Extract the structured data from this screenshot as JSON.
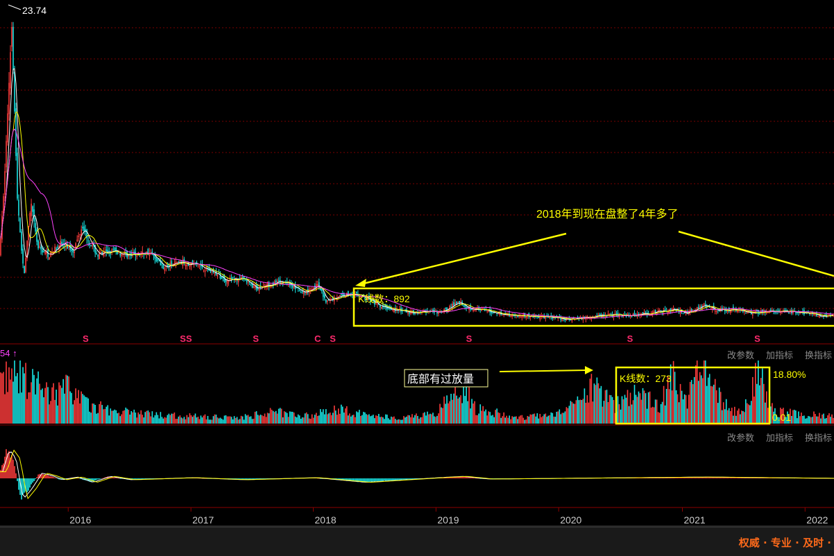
{
  "toolbar_vol": {
    "change_params": "改参数",
    "add_indicator": "加指标",
    "switch_indicator": "换指标"
  },
  "toolbar_macd": {
    "change_params": "改参数",
    "add_indicator": "加指标",
    "switch_indicator": "换指标"
  },
  "footer": {
    "slogan": "权威 · 专业 · 及时 ·"
  },
  "colors": {
    "up": "#ff3d3d",
    "down": "#19e6e6",
    "highlight": "#ffff00",
    "grid": "#8b0000",
    "marker": "#ff2a6d",
    "axis_text": "#cccccc"
  },
  "chart_data": [
    {
      "type": "candlestick",
      "panel": "price",
      "peak_label": "23.74",
      "peak_value": 23.74,
      "x_ticks": [
        "2016",
        "2017",
        "2018",
        "2019",
        "2020",
        "2021",
        "2022"
      ],
      "x_tick_dates": [
        "2016-01-04",
        "2017-01-03",
        "2018-01-02",
        "2019-01-02",
        "2020-01-02",
        "2021-01-04",
        "2022-01-04"
      ],
      "x_range": [
        "2015-06-15",
        "2022-03-31"
      ],
      "ylim": [
        4.5,
        24.5
      ],
      "price_path": [
        [
          "2015-06-15",
          9.5
        ],
        [
          "2015-07-01",
          15
        ],
        [
          "2015-07-20",
          23.74
        ],
        [
          "2015-08-05",
          13
        ],
        [
          "2015-08-25",
          8
        ],
        [
          "2015-09-15",
          12.5
        ],
        [
          "2015-10-05",
          9.8
        ],
        [
          "2015-11-10",
          9.3
        ],
        [
          "2015-12-10",
          10.1
        ],
        [
          "2016-01-20",
          9.6
        ],
        [
          "2016-02-15",
          11.2
        ],
        [
          "2016-03-05",
          10.2
        ],
        [
          "2016-04-01",
          9.3
        ],
        [
          "2016-05-15",
          9.6
        ],
        [
          "2016-07-01",
          9.3
        ],
        [
          "2016-09-01",
          9.5
        ],
        [
          "2016-10-15",
          8.6
        ],
        [
          "2016-12-01",
          8.9
        ],
        [
          "2017-01-15",
          8.8
        ],
        [
          "2017-03-01",
          8.4
        ],
        [
          "2017-04-15",
          7.8
        ],
        [
          "2017-06-01",
          7.9
        ],
        [
          "2017-07-15",
          7.3
        ],
        [
          "2017-09-01",
          7.6
        ],
        [
          "2017-10-15",
          7.7
        ],
        [
          "2017-12-01",
          7.0
        ],
        [
          "2018-01-15",
          7.5
        ],
        [
          "2018-02-10",
          6.5
        ],
        [
          "2018-03-15",
          6.8
        ],
        [
          "2018-05-01",
          7.0
        ],
        [
          "2018-06-20",
          6.6
        ],
        [
          "2018-07-15",
          6.2
        ],
        [
          "2018-09-01",
          6.0
        ],
        [
          "2018-10-20",
          5.8
        ],
        [
          "2018-12-01",
          5.9
        ],
        [
          "2019-01-15",
          5.8
        ],
        [
          "2019-02-15",
          6.2
        ],
        [
          "2019-03-10",
          6.5
        ],
        [
          "2019-04-10",
          6.1
        ],
        [
          "2019-06-01",
          5.9
        ],
        [
          "2019-08-01",
          5.7
        ],
        [
          "2019-10-01",
          5.6
        ],
        [
          "2019-12-01",
          5.55
        ],
        [
          "2020-02-01",
          5.4
        ],
        [
          "2020-04-15",
          5.6
        ],
        [
          "2020-06-01",
          5.7
        ],
        [
          "2020-08-01",
          5.65
        ],
        [
          "2020-10-01",
          5.8
        ],
        [
          "2020-12-01",
          6.0
        ],
        [
          "2021-01-15",
          5.8
        ],
        [
          "2021-03-10",
          6.3
        ],
        [
          "2021-04-15",
          6.0
        ],
        [
          "2021-06-01",
          6.0
        ],
        [
          "2021-08-01",
          5.8
        ],
        [
          "2021-10-01",
          5.9
        ],
        [
          "2021-12-01",
          5.85
        ],
        [
          "2022-02-01",
          5.7
        ],
        [
          "2022-03-31",
          5.6
        ]
      ],
      "event_markers": [
        {
          "date": "2016-02-25",
          "label": "S"
        },
        {
          "date": "2016-12-10",
          "label": "S"
        },
        {
          "date": "2016-12-28",
          "label": "S"
        },
        {
          "date": "2017-07-15",
          "label": "S"
        },
        {
          "date": "2018-01-15",
          "label": "C"
        },
        {
          "date": "2018-03-01",
          "label": "S"
        },
        {
          "date": "2019-04-10",
          "label": "S"
        },
        {
          "date": "2020-08-01",
          "label": "S"
        },
        {
          "date": "2021-08-15",
          "label": "S"
        }
      ],
      "annotations": {
        "consolidation_text": "2018年到现在盘整了4年多了",
        "box_label": "K线数：892"
      }
    },
    {
      "type": "bar",
      "panel": "volume",
      "indicator_label": "54 ↑",
      "top_value_label": "18.80%",
      "bottom_value_label": "0.01",
      "top_value": 18.8,
      "bottom_value": 0.01,
      "annotations": {
        "volume_note": "底部有过放量",
        "box_label": "K线数：273"
      },
      "volume_path": [
        [
          "2015-06-15",
          7
        ],
        [
          "2015-07-20",
          8
        ],
        [
          "2015-09-01",
          7.5
        ],
        [
          "2015-11-01",
          5
        ],
        [
          "2016-01-15",
          6
        ],
        [
          "2016-03-01",
          3
        ],
        [
          "2016-06-01",
          2
        ],
        [
          "2016-09-01",
          1.5
        ],
        [
          "2017-01-01",
          1.2
        ],
        [
          "2017-06-01",
          1.0
        ],
        [
          "2017-09-15",
          2.0
        ],
        [
          "2018-01-01",
          1.2
        ],
        [
          "2018-03-01",
          2.5
        ],
        [
          "2018-06-01",
          1.5
        ],
        [
          "2018-09-01",
          1.0
        ],
        [
          "2019-01-01",
          1.5
        ],
        [
          "2019-03-15",
          6.5
        ],
        [
          "2019-05-01",
          2.5
        ],
        [
          "2019-09-01",
          1.0
        ],
        [
          "2020-01-01",
          1.5
        ],
        [
          "2020-04-15",
          6
        ],
        [
          "2020-06-15",
          3
        ],
        [
          "2020-09-01",
          5
        ],
        [
          "2020-11-01",
          3
        ],
        [
          "2020-12-01",
          8
        ],
        [
          "2021-01-15",
          4
        ],
        [
          "2021-03-01",
          10
        ],
        [
          "2021-04-15",
          5
        ],
        [
          "2021-06-01",
          2
        ],
        [
          "2021-07-15",
          3
        ],
        [
          "2021-08-15",
          9
        ],
        [
          "2021-10-01",
          2
        ],
        [
          "2022-01-01",
          1.5
        ],
        [
          "2022-03-31",
          1.2
        ]
      ]
    },
    {
      "type": "bar",
      "panel": "macd",
      "macd_path": [
        [
          "2015-06-15",
          0.5
        ],
        [
          "2015-07-05",
          2.2
        ],
        [
          "2015-07-25",
          1.5
        ],
        [
          "2015-08-15",
          -1.6
        ],
        [
          "2015-09-10",
          -0.8
        ],
        [
          "2015-10-10",
          0.4
        ],
        [
          "2015-11-10",
          0.2
        ],
        [
          "2015-12-10",
          -0.1
        ],
        [
          "2016-01-25",
          0.1
        ],
        [
          "2016-03-10",
          -0.3
        ],
        [
          "2016-05-01",
          0.15
        ],
        [
          "2016-07-01",
          -0.1
        ],
        [
          "2017-01-01",
          0.05
        ],
        [
          "2017-06-01",
          -0.1
        ],
        [
          "2018-01-01",
          0.05
        ],
        [
          "2018-06-01",
          -0.3
        ],
        [
          "2019-01-01",
          0.05
        ],
        [
          "2019-03-15",
          0.15
        ],
        [
          "2019-06-01",
          -0.05
        ],
        [
          "2020-01-01",
          0.0
        ],
        [
          "2021-03-10",
          0.1
        ],
        [
          "2022-03-31",
          0.0
        ]
      ]
    }
  ]
}
